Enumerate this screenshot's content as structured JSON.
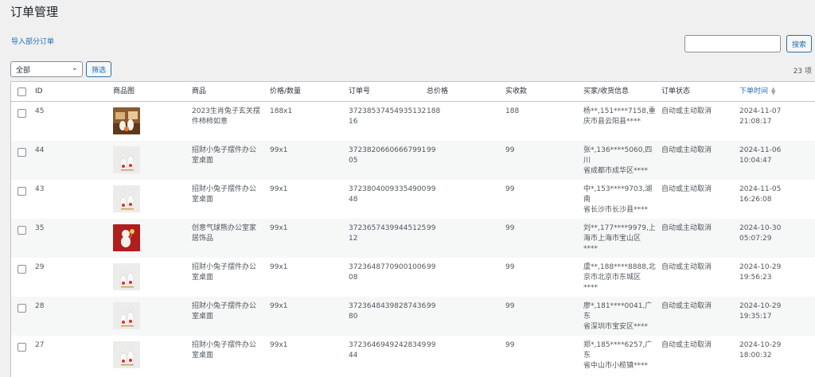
{
  "page": {
    "title": "订单管理",
    "import_link": "导入部分订单",
    "search_button": "搜索",
    "search_placeholder": "",
    "filter_select": "全部",
    "filter_button": "筛选",
    "item_count": "23 项"
  },
  "table": {
    "headers": [
      "ID",
      "商品图",
      "商品",
      "价格/数量",
      "订单号",
      "总价格",
      "实收款",
      "买家/收货信息",
      "订单状态",
      "下单时间"
    ],
    "rows": [
      {
        "id": "45",
        "thumb": "desk",
        "product": [
          "2023生肖兔子玄关摆",
          "件柿柿如意"
        ],
        "price_qty": "188x1",
        "order_no": [
          "37238537454935132",
          "16"
        ],
        "total": "188",
        "paid": "188",
        "buyer": [
          "杨**,151****7158,重",
          "庆市县云阳县****"
        ],
        "status": "自动或主动取消",
        "time": "2024-11-07 21:08:17"
      },
      {
        "id": "44",
        "thumb": "bunny",
        "product": [
          "招财小兔子摆件办公",
          "室桌面"
        ],
        "price_qty": "99x1",
        "order_no": [
          "37238206606667991",
          "05"
        ],
        "total": "99",
        "paid": "99",
        "buyer": [
          "张*,136****5060,四川",
          "省成都市成华区****"
        ],
        "status": "自动或主动取消",
        "time": "2024-11-06 10:04:47"
      },
      {
        "id": "43",
        "thumb": "bunny",
        "product": [
          "招财小兔子摆件办公",
          "室桌面"
        ],
        "price_qty": "99x1",
        "order_no": [
          "37238040093354900",
          "48"
        ],
        "total": "99",
        "paid": "99",
        "buyer": [
          "中*,153****9703,湖南",
          "省长沙市长沙县****"
        ],
        "status": "自动或主动取消",
        "time": "2024-11-05 16:26:08"
      },
      {
        "id": "35",
        "thumb": "red",
        "product": [
          "创意气球熊办公室家",
          "居饰品"
        ],
        "price_qty": "99x1",
        "order_no": [
          "37236574399445125",
          "12"
        ],
        "total": "99",
        "paid": "99",
        "buyer": [
          "刘**,177****9979,上",
          "海市上海市宝山区",
          "****"
        ],
        "status": "自动或主动取消",
        "time": "2024-10-30 05:07:29"
      },
      {
        "id": "29",
        "thumb": "bunny",
        "product": [
          "招财小兔子摆件办公",
          "室桌面"
        ],
        "price_qty": "99x1",
        "order_no": [
          "37236487709001006",
          "08"
        ],
        "total": "99",
        "paid": "99",
        "buyer": [
          "虞**,188****8888,北",
          "京市北京市东城区",
          "****"
        ],
        "status": "自动或主动取消",
        "time": "2024-10-29 19:56:23"
      },
      {
        "id": "28",
        "thumb": "bunny",
        "product": [
          "招财小兔子摆件办公",
          "室桌面"
        ],
        "price_qty": "99x1",
        "order_no": [
          "37236484398287436",
          "80"
        ],
        "total": "99",
        "paid": "99",
        "buyer": [
          "廖*,181****0041,广东",
          "省深圳市宝安区****"
        ],
        "status": "自动或主动取消",
        "time": "2024-10-29 19:35:17"
      },
      {
        "id": "27",
        "thumb": "bunny",
        "product": [
          "招财小兔子摆件办公",
          "室桌面"
        ],
        "price_qty": "99x1",
        "order_no": [
          "37236469492428349",
          "44"
        ],
        "total": "99",
        "paid": "99",
        "buyer": [
          "郑*,185****6257,广东",
          "省中山市小榄镇****"
        ],
        "status": "自动或主动取消",
        "time": "2024-10-29 18:00:32"
      }
    ]
  },
  "colors": {
    "link": "#2271b1",
    "border": "#c3c4c7",
    "background": "#f0f0f1"
  }
}
